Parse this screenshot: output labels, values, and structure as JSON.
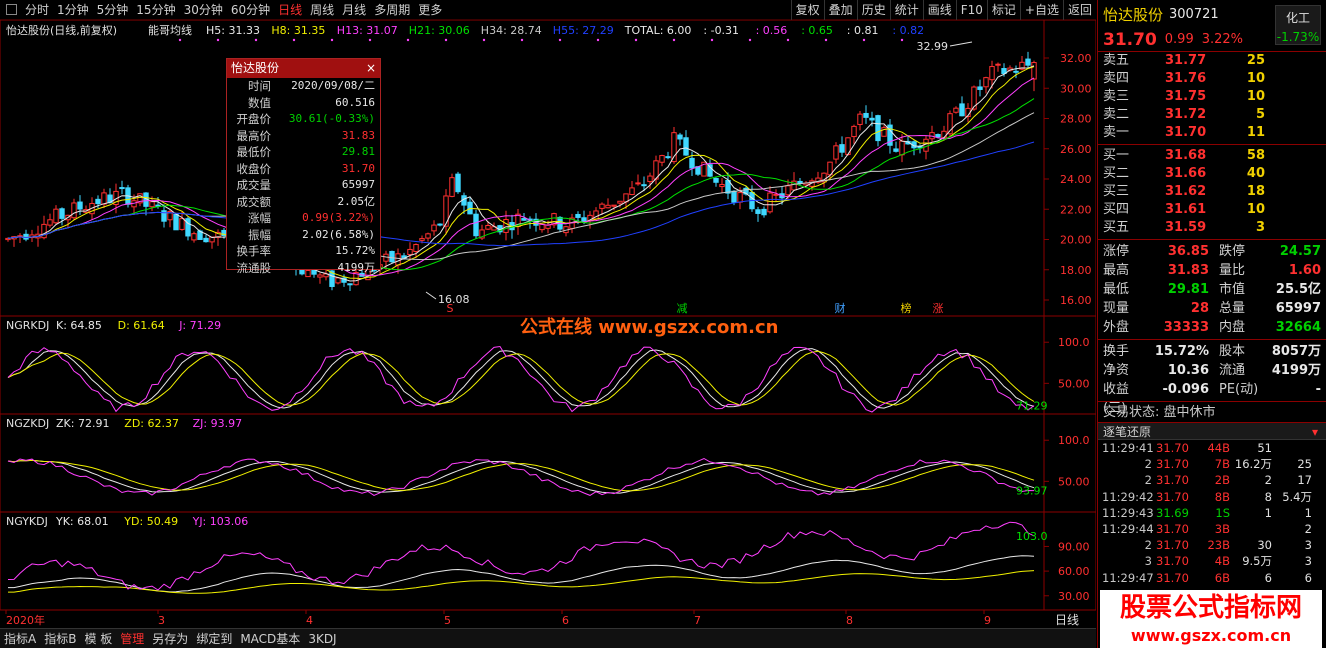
{
  "toolbar": {
    "periods": [
      "分时",
      "1分钟",
      "5分钟",
      "15分钟",
      "30分钟",
      "60分钟",
      "日线",
      "周线",
      "月线",
      "多周期",
      "更多"
    ],
    "active": "日线",
    "right": [
      "复权",
      "叠加",
      "历史",
      "统计",
      "画线",
      "F10",
      "标记",
      "+自选",
      "返回"
    ]
  },
  "chart_title": {
    "stock": "怡达股份(日线,前复权)",
    "indicator": "能哥均线",
    "items": [
      {
        "t": "H5: 31.33",
        "c": "#e8e8e8"
      },
      {
        "t": "H8: 31.35",
        "c": "#f0f000"
      },
      {
        "t": "H13: 31.07",
        "c": "#ff40ff"
      },
      {
        "t": "H21: 30.06",
        "c": "#00e000"
      },
      {
        "t": "H34: 28.74",
        "c": "#c8c8c8"
      },
      {
        "t": "H55: 27.29",
        "c": "#2040ff"
      },
      {
        "t": "TOTAL: 6.00",
        "c": "#e8e8e8"
      },
      {
        "t": ": -0.31",
        "c": "#e8e8e8"
      },
      {
        "t": ": 0.56",
        "c": "#ff40ff"
      },
      {
        "t": ": 0.65",
        "c": "#00e000"
      },
      {
        "t": ": 0.81",
        "c": "#e8e8e8"
      },
      {
        "t": ": 0.82",
        "c": "#2040ff"
      }
    ]
  },
  "price_axis": [
    "32.00",
    "30.00",
    "28.00",
    "26.00",
    "24.00",
    "22.00",
    "20.00",
    "18.00",
    "16.00"
  ],
  "annotations": {
    "high": "32.99",
    "low": "16.08",
    "markers": [
      "S",
      "减",
      "财",
      "榜",
      "涨"
    ]
  },
  "panel1": {
    "name": "NGRKDJ",
    "items": [
      {
        "t": "K: 64.85",
        "c": "#e8e8e8"
      },
      {
        "t": "D: 61.64",
        "c": "#f0f000"
      },
      {
        "t": "J: 71.29",
        "c": "#ff40ff"
      }
    ],
    "axis": [
      "100.0",
      "50.00"
    ],
    "last": "71.29"
  },
  "panel2": {
    "name": "NGZKDJ",
    "items": [
      {
        "t": "ZK: 72.91",
        "c": "#e8e8e8"
      },
      {
        "t": "ZD: 62.37",
        "c": "#f0f000"
      },
      {
        "t": "ZJ: 93.97",
        "c": "#ff40ff"
      }
    ],
    "axis": [
      "100.0",
      "50.00"
    ],
    "last": "93.97"
  },
  "panel3": {
    "name": "NGYKDJ",
    "items": [
      {
        "t": "YK: 68.01",
        "c": "#e8e8e8"
      },
      {
        "t": "YD: 50.49",
        "c": "#f0f000"
      },
      {
        "t": "YJ: 103.06",
        "c": "#ff40ff"
      }
    ],
    "axis": [
      "90.00",
      "60.00",
      "30.00"
    ],
    "last": "103.0"
  },
  "x_labels": [
    "2020年",
    "3",
    "4",
    "5",
    "6",
    "7",
    "8",
    "9"
  ],
  "period_tag": "日线",
  "watermark": {
    "center": "公式在线 www.gszx.com.cn",
    "big": "股票公式指标网",
    "url": "www.gszx.com.cn"
  },
  "popup": {
    "title": "怡达股份",
    "rows": [
      {
        "k": "时间",
        "v": "2020/09/08/二",
        "c": "#e8e8e8"
      },
      {
        "k": "数值",
        "v": "60.516",
        "c": "#e8e8e8"
      },
      {
        "k": "开盘价",
        "v": "30.61(-0.33%)",
        "c": "#00d000"
      },
      {
        "k": "最高价",
        "v": "31.83",
        "c": "#ff3030"
      },
      {
        "k": "最低价",
        "v": "29.81",
        "c": "#00d000"
      },
      {
        "k": "收盘价",
        "v": "31.70",
        "c": "#ff3030"
      },
      {
        "k": "成交量",
        "v": "65997",
        "c": "#e8e8e8"
      },
      {
        "k": "成交额",
        "v": "2.05亿",
        "c": "#e8e8e8"
      },
      {
        "k": "涨幅",
        "v": "0.99(3.22%)",
        "c": "#ff3030"
      },
      {
        "k": "振幅",
        "v": "2.02(6.58%)",
        "c": "#e8e8e8"
      },
      {
        "k": "换手率",
        "v": "15.72%",
        "c": "#e8e8e8"
      },
      {
        "k": "流通股",
        "v": "4199万",
        "c": "#e8e8e8"
      }
    ]
  },
  "bottom": {
    "items": [
      "指标A",
      "指标B",
      "模 板",
      "管理",
      "另存为",
      "绑定到",
      "MACD基本",
      "3KDJ"
    ],
    "active": "管理"
  },
  "sidebar": {
    "name": "怡达股份",
    "code": "300721",
    "sector": "化工",
    "sector_pct": "-1.73%",
    "price": "31.70",
    "change": "0.99",
    "pct": "3.22%",
    "asks": [
      {
        "l": "卖五",
        "p": "31.77",
        "v": "25"
      },
      {
        "l": "卖四",
        "p": "31.76",
        "v": "10"
      },
      {
        "l": "卖三",
        "p": "31.75",
        "v": "10"
      },
      {
        "l": "卖二",
        "p": "31.72",
        "v": "5"
      },
      {
        "l": "卖一",
        "p": "31.70",
        "v": "11"
      }
    ],
    "bids": [
      {
        "l": "买一",
        "p": "31.68",
        "v": "58"
      },
      {
        "l": "买二",
        "p": "31.66",
        "v": "40"
      },
      {
        "l": "买三",
        "p": "31.62",
        "v": "18"
      },
      {
        "l": "买四",
        "p": "31.61",
        "v": "10"
      },
      {
        "l": "买五",
        "p": "31.59",
        "v": "3"
      }
    ],
    "stats": [
      {
        "k": "涨停",
        "v": "36.85",
        "c": "red",
        "k2": "跌停",
        "v2": "24.57",
        "c2": "green"
      },
      {
        "k": "最高",
        "v": "31.83",
        "c": "red",
        "k2": "量比",
        "v2": "1.60",
        "c2": "red"
      },
      {
        "k": "最低",
        "v": "29.81",
        "c": "green",
        "k2": "市值",
        "v2": "25.5亿",
        "c2": "wht"
      },
      {
        "k": "现量",
        "v": "28",
        "c": "red",
        "k2": "总量",
        "v2": "65997",
        "c2": "wht"
      },
      {
        "k": "外盘",
        "v": "33333",
        "c": "red",
        "k2": "内盘",
        "v2": "32664",
        "c2": "green"
      }
    ],
    "stats2": [
      {
        "k": "换手",
        "v": "15.72%",
        "c": "wht",
        "k2": "股本",
        "v2": "8057万",
        "c2": "wht"
      },
      {
        "k": "净资",
        "v": "10.36",
        "c": "wht",
        "k2": "流通",
        "v2": "4199万",
        "c2": "wht"
      },
      {
        "k": "收益(三)",
        "v": "-0.096",
        "c": "wht",
        "k2": "PE(动)",
        "v2": "-",
        "c2": "wht"
      }
    ],
    "state": "交易状态: 盘中休市",
    "ticks_title": "逐笔还原",
    "ticks": [
      {
        "t": "11:29:41",
        "p": "31.70",
        "v": "44B",
        "x": "51",
        "y": ""
      },
      {
        "t": "2",
        "p": "31.70",
        "v": "7B",
        "x": "16.2万",
        "y": "25"
      },
      {
        "t": "2",
        "p": "31.70",
        "v": "2B",
        "x": "2",
        "y": "17"
      },
      {
        "t": "11:29:42",
        "p": "31.70",
        "v": "8B",
        "x": "8",
        "y": "5.4万"
      },
      {
        "t": "11:29:43",
        "p": "31.69",
        "v": "1S",
        "x": "1",
        "y": "1"
      },
      {
        "t": "11:29:44",
        "p": "31.70",
        "v": "3B",
        "x": "",
        "y": "2"
      },
      {
        "t": "2",
        "p": "31.70",
        "v": "23B",
        "x": "30",
        "y": "3"
      },
      {
        "t": "3",
        "p": "31.70",
        "v": "4B",
        "x": "9.5万",
        "y": "3"
      },
      {
        "t": "11:29:47",
        "p": "31.70",
        "v": "6B",
        "x": "6",
        "y": "6"
      }
    ]
  }
}
